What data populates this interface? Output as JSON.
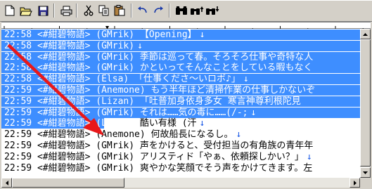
{
  "toolbar": {
    "buttons": [
      {
        "name": "new-file-button",
        "icon": "new-file-icon"
      },
      {
        "name": "open-folder-button",
        "icon": "open-folder-icon"
      },
      {
        "name": "save-button",
        "icon": "save-icon"
      },
      {
        "name": "print-button",
        "icon": "printer-icon"
      },
      {
        "name": "cut-button",
        "icon": "scissors-icon"
      },
      {
        "name": "copy-button",
        "icon": "copy-icon"
      },
      {
        "name": "paste-button",
        "icon": "paste-icon"
      },
      {
        "name": "undo-button",
        "icon": "undo-icon"
      },
      {
        "name": "redo-button",
        "icon": "redo-icon"
      },
      {
        "name": "find-button",
        "icon": "binoculars-icon"
      },
      {
        "name": "find-next-button",
        "icon": "binoculars-up-icon"
      },
      {
        "name": "find-prev-button",
        "icon": "binoculars-down-icon"
      }
    ]
  },
  "colors": {
    "selection": "#3e8eff",
    "eol_marker": "#1555e6",
    "annotation_arrow": "#e8181a"
  },
  "log_lines": [
    {
      "time": "22:58",
      "text": "22:58 <#紺碧物語> (GMrik) 【Opening】",
      "eol": "↓",
      "selected": true
    },
    {
      "time": "22:58",
      "text": "22:58 <#紺碧物語> (GMrik)",
      "eol": "↓",
      "selected": true
    },
    {
      "time": "22:58",
      "text": "22:58 <#紺碧物語> (GMrik) 季節は巡って春。そろそろ仕事や奇特な人",
      "eol": "",
      "selected": true
    },
    {
      "time": "22:58",
      "text": "22:58 <#紺碧物語> (GMrik) かといってそんなことをしている暇もなく",
      "eol": "",
      "selected": true
    },
    {
      "time": "22:58",
      "text": "22:58 <#紺碧物語> (Elsa) 「仕事くださ～いロボ♪」",
      "eol": "↓",
      "selected": true
    },
    {
      "time": "22:59",
      "text": "22:59 <#紺碧物語> (Anemone) もう半年ほど清掃作業の仕事しかないぞ",
      "eol": "",
      "selected": true
    },
    {
      "time": "22:59",
      "text": "22:59 <#紺碧物語> (Lizan) 「吐普加身依身多女 寒言神尊利根陀見",
      "eol": "",
      "selected": true
    },
    {
      "time": "22:59",
      "text": "22:59 <#紺碧物語> (GMrik) それは……気の毒に……(/-;",
      "eol": "↓",
      "selected": true
    },
    {
      "time": "22:59",
      "text": "22:59 <#紺碧物語> (Lizan) 酷い有様 (汗",
      "eol": "↓",
      "selected": "partial"
    },
    {
      "time": "22:59",
      "text": "22:59 <#紺碧物語> (Anemone) 何故船長になるし。",
      "eol": "↓",
      "selected": false
    },
    {
      "time": "22:59",
      "text": "22:59 <#紺碧物語> (GMrik) 声をかけると、受付担当の有角族の青年年",
      "eol": "",
      "selected": false
    },
    {
      "time": "22:59",
      "text": "22:59 <#紺碧物語> (GMrik) アリスティド「やぁ、依頼探しかい？」",
      "eol": "↓",
      "selected": false
    },
    {
      "time": "22:59",
      "text": "22:59 <#紺碧物語> (GMrik) 爽やかな笑顔でそう声をかけてきます。左",
      "eol": "",
      "selected": false
    }
  ]
}
